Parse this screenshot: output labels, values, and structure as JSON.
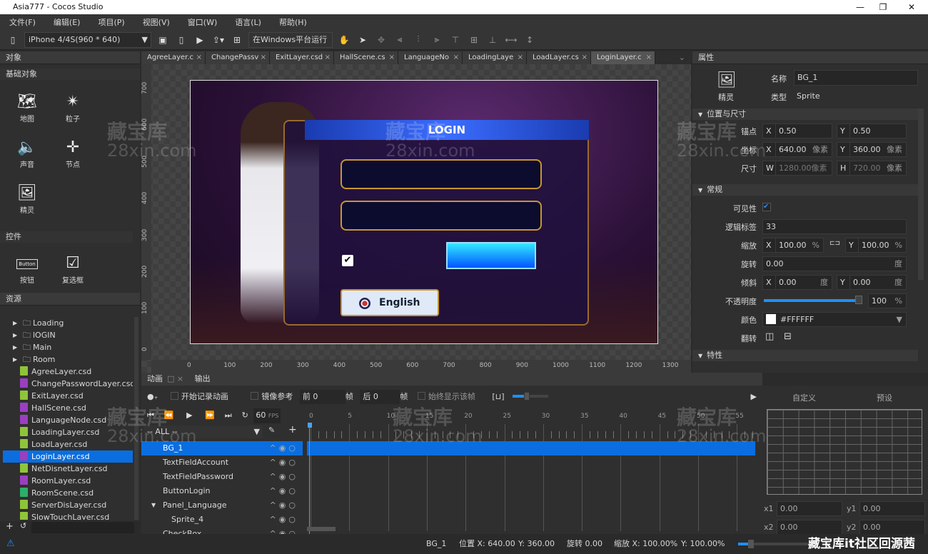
{
  "window": {
    "title": "Asia777 - Cocos Studio",
    "controls": [
      "—",
      "❐",
      "✕"
    ]
  },
  "menu": [
    "文件(F)",
    "编辑(E)",
    "项目(P)",
    "视图(V)",
    "窗口(W)",
    "语言(L)",
    "帮助(H)"
  ],
  "toolbar": {
    "device": "iPhone 4/4S(960 * 640)",
    "run": "在Windows平台运行"
  },
  "objects_panel": {
    "title": "对象",
    "basic_section": "基础对象",
    "basic_items": [
      {
        "label": "地图",
        "icon": "map-icon"
      },
      {
        "label": "粒子",
        "icon": "particle-icon"
      },
      {
        "label": "声音",
        "icon": "sound-icon"
      },
      {
        "label": "节点",
        "icon": "node-icon"
      },
      {
        "label": "精灵",
        "icon": "sprite-icon"
      }
    ],
    "controls_section": "控件",
    "control_items": [
      {
        "label": "按钮",
        "icon": "button-icon",
        "glyph": "Button"
      },
      {
        "label": "复选框",
        "icon": "checkbox-icon"
      }
    ]
  },
  "resources_panel": {
    "title": "资源",
    "folders": [
      "Loading",
      "lOGIN",
      "Main",
      "Room"
    ],
    "files": [
      {
        "name": "AgreeLayer.csd",
        "color": "#8fc43a"
      },
      {
        "name": "ChangePasswordLayer.csd",
        "color": "#9a3fc0"
      },
      {
        "name": "ExitLayer.csd",
        "color": "#8fc43a"
      },
      {
        "name": "HallScene.csd",
        "color": "#9a3fc0"
      },
      {
        "name": "LanguageNode.csd",
        "color": "#9a3fc0"
      },
      {
        "name": "LoadingLayer.csd",
        "color": "#8fc43a"
      },
      {
        "name": "LoadLayer.csd",
        "color": "#8fc43a"
      },
      {
        "name": "LoginLayer.csd",
        "color": "#9a3fc0",
        "selected": true
      },
      {
        "name": "NetDisnetLayer.csd",
        "color": "#8fc43a"
      },
      {
        "name": "RoomLayer.csd",
        "color": "#9a3fc0"
      },
      {
        "name": "RoomScene.csd",
        "color": "#2fae6a"
      },
      {
        "name": "ServerDisLayer.csd",
        "color": "#8fc43a"
      },
      {
        "name": "SlowTouchLayer.csd",
        "color": "#8fc43a"
      }
    ]
  },
  "editor_tabs": [
    "AgreeLayer.c",
    "ChangePassv",
    "ExitLayer.csd",
    "HallScene.cs",
    "LanguageNo",
    "LoadingLaye",
    "LoadLayer.cs",
    "LoginLayer.c"
  ],
  "active_tab": 7,
  "rulers": {
    "x": [
      "0",
      "100",
      "200",
      "300",
      "400",
      "500",
      "600",
      "700",
      "800",
      "900",
      "1000",
      "1100",
      "1200",
      "1300"
    ],
    "y": [
      "700",
      "600",
      "500",
      "400",
      "300",
      "200",
      "100",
      "0"
    ]
  },
  "scene": {
    "title": "LOGIN",
    "language_button": "English",
    "accent": "#1e8fff"
  },
  "properties": {
    "title": "属性",
    "type_icon_label": "精灵",
    "name_label": "名称",
    "name": "BG_1",
    "type_label": "类型",
    "type": "Sprite",
    "sec_pos": "位置与尺寸",
    "anchor_label": "锚点",
    "anchor_x": "0.50",
    "anchor_y": "0.50",
    "pos_label": "坐标",
    "pos_x": "640.00",
    "pos_y": "360.00",
    "unit_px": "像素",
    "size_label": "尺寸",
    "size_w": "1280.00像素",
    "size_h": "720.00",
    "sec_general": "常规",
    "visible_label": "可见性",
    "visible": true,
    "tag_label": "逻辑标签",
    "tag": "33",
    "scale_label": "缩放",
    "scale_x": "100.00",
    "scale_y": "100.00",
    "pct": "%",
    "rotate_label": "旋转",
    "rotate": "0.00",
    "deg": "度",
    "skew_label": "倾斜",
    "skew_x": "0.00",
    "skew_y": "0.00",
    "opacity_label": "不透明度",
    "opacity": "100",
    "opacity_fraction": 1.0,
    "color_label": "颜色",
    "color": "#FFFFFF",
    "flip_label": "翻转",
    "sec_feature": "特性"
  },
  "animation": {
    "tab": "动画",
    "output_tab": "输出",
    "record": "开始记录动画",
    "mirror": "镜像参考",
    "before": "前",
    "before_val": "0",
    "after": "后",
    "after_val": "0",
    "frame": "帧",
    "always_show": "始终显示该帧",
    "fps": "60",
    "fps_unit": "FPS",
    "filter": "-- ALL --",
    "ticks": [
      "0",
      "5",
      "10",
      "15",
      "20",
      "25",
      "30",
      "35",
      "40",
      "45",
      "50",
      "55"
    ],
    "nodes": [
      {
        "name": "BG_1",
        "selected": true,
        "indent": 0
      },
      {
        "name": "TextFieldAccount",
        "indent": 0
      },
      {
        "name": "TextFieldPassword",
        "indent": 0
      },
      {
        "name": "ButtonLogin",
        "indent": 0
      },
      {
        "name": "Panel_Language",
        "indent": 0,
        "expanded": true
      },
      {
        "name": "Sprite_4",
        "indent": 1
      },
      {
        "name": "CheckBox",
        "indent": 0
      }
    ]
  },
  "easing": {
    "custom": "自定义",
    "preset": "预设",
    "x1_label": "x1",
    "x1": "0.00",
    "y1_label": "y1",
    "y1": "0.00",
    "x2_label": "x2",
    "x2": "0.00",
    "y2_label": "y2",
    "y2": "0.00"
  },
  "status": {
    "name": "BG_1",
    "pos": "位置 X: 640.00",
    "pos_y": "Y: 360.00",
    "rotate": "旋转 0.00",
    "scale": "缩放 X: 100.00%",
    "scale_y": "Y: 100.00%"
  },
  "watermark": {
    "cn": "藏宝库",
    "url": "28xin.com",
    "footer": "藏宝库it社区回源茜"
  }
}
